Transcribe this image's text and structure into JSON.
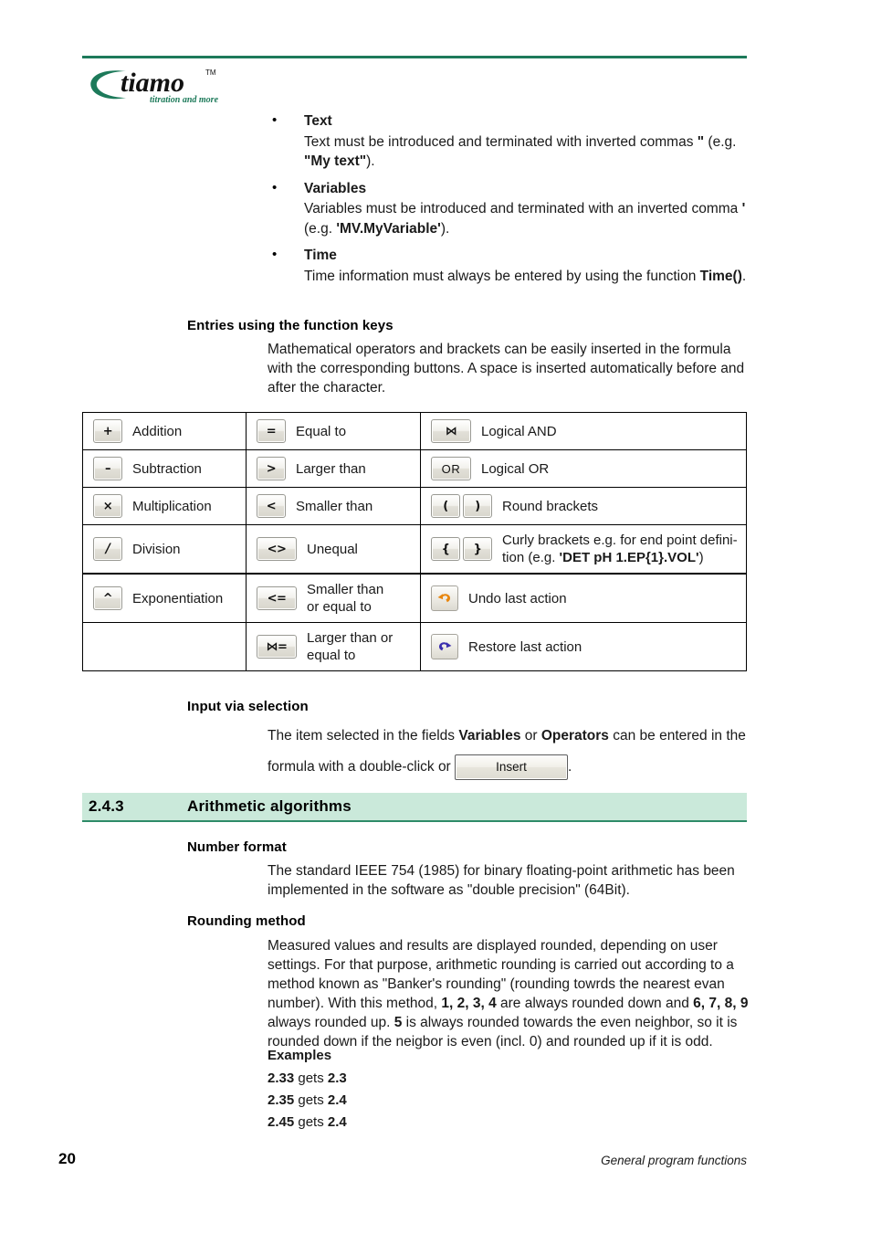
{
  "brand": {
    "logo_text": "tiamo",
    "logo_tm": "TM",
    "tagline": "titration and more",
    "green": "#1d7a5a"
  },
  "bullets": [
    {
      "term": "Text",
      "segments": [
        {
          "t": "Text must be introduced and terminated with inverted commas ",
          "bold": false
        },
        {
          "t": "\"",
          "bold": true
        },
        {
          "t": " (e.g. ",
          "bold": false
        },
        {
          "t": "\"My text\"",
          "bold": true
        },
        {
          "t": ").",
          "bold": false
        }
      ]
    },
    {
      "term": "Variables",
      "segments": [
        {
          "t": "Variables must be introduced and terminated with an inverted comma ",
          "bold": false
        },
        {
          "t": "'",
          "bold": true
        },
        {
          "t": " (e.g. ",
          "bold": false
        },
        {
          "t": "'MV.MyVariable'",
          "bold": true
        },
        {
          "t": ").",
          "bold": false
        }
      ]
    },
    {
      "term": "Time",
      "segments": [
        {
          "t": "Time information must always be entered by using the function ",
          "bold": false
        },
        {
          "t": "Time()",
          "bold": true
        },
        {
          "t": ".",
          "bold": false
        }
      ]
    }
  ],
  "function_keys_section": {
    "heading": "Entries using the function keys",
    "paragraph": "Mathematical operators and brackets can be easily inserted in the formula with the corresponding buttons. A space is inserted automatically before and after the character."
  },
  "key_table": {
    "rows": [
      {
        "a": {
          "icon": "plus-key-icon",
          "glyph": "+",
          "label": "Addition"
        },
        "b": {
          "icon": "equals-key-icon",
          "glyph": "=",
          "label": "Equal to"
        },
        "c": {
          "icon": "logical-and-key-icon",
          "glyph": "⋈",
          "label": "Logical AND"
        }
      },
      {
        "a": {
          "icon": "minus-key-icon",
          "glyph": "–",
          "label": "Subtraction"
        },
        "b": {
          "icon": "greater-than-key-icon",
          "glyph": ">",
          "label": "Larger than"
        },
        "c": {
          "icon": "logical-or-key-icon",
          "glyph": "OR",
          "label": "Logical OR"
        }
      },
      {
        "a": {
          "icon": "multiply-key-icon",
          "glyph": "×",
          "label": "Multiplication"
        },
        "b": {
          "icon": "less-than-key-icon",
          "glyph": "<",
          "label": "Smaller than"
        },
        "c": {
          "icon": "round-brackets-key-icon",
          "glyph": "(",
          "glyph2": ")",
          "label": "Round brackets"
        }
      },
      {
        "a": {
          "icon": "divide-key-icon",
          "glyph": "/",
          "label": "Division"
        },
        "b": {
          "icon": "unequal-key-icon",
          "glyph": "<>",
          "label": "Unequal"
        },
        "c": {
          "icon": "curly-brackets-key-icon",
          "glyph": "{",
          "glyph2": "}",
          "label": "Curly brackets e.g. for end point defini-tion (e.g. ",
          "label_bold": "'DET pH 1.EP{1}.VOL'",
          "label_tail": ")"
        }
      },
      {
        "a": {
          "icon": "exponent-key-icon",
          "glyph": "^",
          "label": "Exponentiation"
        },
        "b": {
          "icon": "less-equal-key-icon",
          "glyph": "<=",
          "label": "Smaller than or equal to"
        },
        "c": {
          "icon": "undo-icon",
          "glyph": "",
          "label": "Undo last action"
        }
      },
      {
        "a": {
          "icon": "",
          "glyph": "",
          "label": ""
        },
        "b": {
          "icon": "greater-equal-key-icon",
          "glyph": "⋈=",
          "label": "Larger than or equal to"
        },
        "c": {
          "icon": "redo-icon",
          "glyph": "",
          "label": "Restore last action"
        }
      }
    ],
    "curly_line1": "Curly brackets e.g. for end point defini-",
    "curly_line2_pre": "tion (e.g. ",
    "curly_line2_bold": "'DET pH 1.EP{1}.VOL'",
    "curly_line2_post": ")",
    "less_equal_line1": "Smaller than",
    "less_equal_line2": "or equal to",
    "greater_equal_line1": "Larger than or",
    "greater_equal_line2": "equal to"
  },
  "input_selection": {
    "heading": "Input via selection",
    "text_pre": "The item selected in the fields ",
    "field_1": "Variables",
    "text_mid": " or ",
    "field_2": "Operators",
    "text_post": " can be entered in the",
    "line2_pre": "formula with a double-click or ",
    "insert_button": "Insert",
    "line2_post": "."
  },
  "section": {
    "number": "2.4.3",
    "title": "Arithmetic algorithms",
    "banner_bg": "#cae9da",
    "banner_rule": "#2e8b68"
  },
  "number_format": {
    "heading": "Number format",
    "paragraph": "The standard IEEE 754 (1985) for binary floating-point arithmetic has been implemented in the software as \"double precision\" (64Bit)."
  },
  "rounding": {
    "heading": "Rounding method",
    "segments": [
      {
        "t": "Measured values and results are displayed rounded, depending on user settings. For that purpose, arithmetic rounding is carried out according to a method known as \"Banker's rounding\" (rounding towrds the nearest evan number). With this method,  ",
        "bold": false
      },
      {
        "t": "1, 2, 3, 4",
        "bold": true
      },
      {
        "t": " are always rounded down and ",
        "bold": false
      },
      {
        "t": "6, 7, 8, 9",
        "bold": true
      },
      {
        "t": " always rounded up. ",
        "bold": false
      },
      {
        "t": "5",
        "bold": true
      },
      {
        "t": " is always rounded towards the even neighbor, so it is rounded down if the neigbor is even (incl. 0) and rounded up if it is odd.",
        "bold": false
      }
    ]
  },
  "examples": {
    "heading": "Examples",
    "rows": [
      {
        "from": "2.33",
        "verb": "gets",
        "to": "2.3"
      },
      {
        "from": "2.35",
        "verb": "gets",
        "to": "2.4"
      },
      {
        "from": "2.45",
        "verb": "gets",
        "to": "2.4"
      }
    ]
  },
  "footer": {
    "page_number": "20",
    "running_head": "General program functions"
  }
}
